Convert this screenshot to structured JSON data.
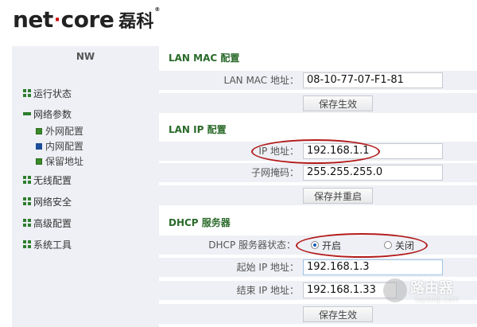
{
  "header": {
    "brand_latin_left": "net",
    "brand_dot": "·",
    "brand_latin_right": "core",
    "brand_cn": "磊科",
    "brand_reg": "®"
  },
  "sidebar": {
    "top_label": "NW",
    "items": [
      {
        "label": "运行状态",
        "icon": "grid-icon"
      },
      {
        "label": "网络参数",
        "icon": "collapse-minus-icon"
      },
      {
        "label": "无线配置",
        "icon": "grid-icon"
      },
      {
        "label": "网络安全",
        "icon": "grid-icon"
      },
      {
        "label": "高级配置",
        "icon": "grid-icon"
      },
      {
        "label": "系统工具",
        "icon": "grid-icon"
      }
    ],
    "subitems": [
      {
        "label": "外网配置",
        "icon": "green-square-icon"
      },
      {
        "label": "内网配置",
        "icon": "blue-square-icon"
      },
      {
        "label": "保留地址",
        "icon": "green-square-icon"
      }
    ]
  },
  "lan_mac": {
    "title": "LAN MAC 配置",
    "mac_label": "LAN MAC 地址：",
    "mac_value": "08-10-77-07-F1-81",
    "button": "保存生效"
  },
  "lan_ip": {
    "title": "LAN IP 配置",
    "ip_label": "IP 地址：",
    "ip_value": "192.168.1.1",
    "mask_label": "子网掩码：",
    "mask_value": "255.255.255.0",
    "button": "保存并重启"
  },
  "dhcp": {
    "title": "DHCP 服务器",
    "status_label": "DHCP 服务器状态：",
    "option_on": "开启",
    "option_off": "关闭",
    "selected": "开启",
    "start_label": "起始 IP 地址：",
    "start_value": "192.168.1.3",
    "end_label": "结束 IP 地址：",
    "end_value": "192.168.1.33",
    "button": "保存生效"
  },
  "watermark": {
    "text": "路由器",
    "sub": "luyouqi.com"
  },
  "colors": {
    "section_title": "#2a6a2a",
    "row_bg": "#eef0f5",
    "annotation": "#b31b1b",
    "icon_green": "#2f7d2f",
    "icon_blue": "#1e4e9a"
  }
}
